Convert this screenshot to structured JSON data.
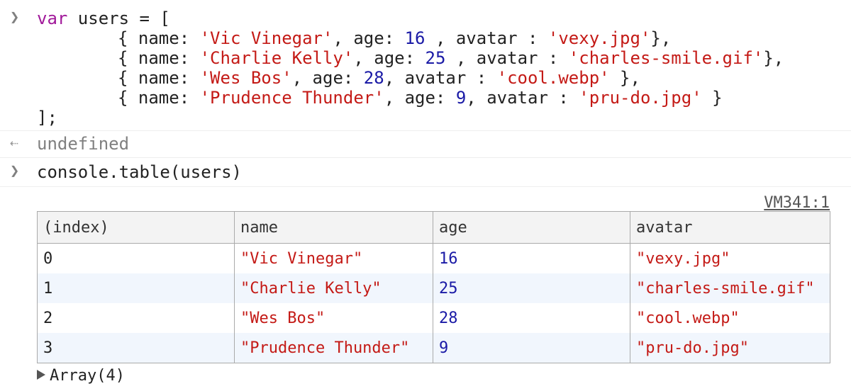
{
  "input1": {
    "prompt": ">",
    "code": {
      "l1_kw": "var",
      "l1_rest": " users = [",
      "rows": [
        {
          "name": "'Vic Vinegar'",
          "age": "16",
          "age_sep": " , ",
          "avatar": "'vexy.jpg'",
          "close": "},"
        },
        {
          "name": "'Charlie Kelly'",
          "age": "25",
          "age_sep": " , ",
          "avatar": "'charles-smile.gif'",
          "close": "},"
        },
        {
          "name": "'Wes Bos'",
          "age": "28",
          "age_sep": ", ",
          "avatar": "'cool.webp'",
          "close": " },"
        },
        {
          "name": "'Prudence Thunder'",
          "age": "9",
          "age_sep": ", ",
          "avatar": "'pru-do.jpg'",
          "close": " }"
        }
      ],
      "closing": "];"
    }
  },
  "output1": {
    "icon": "return-arrow-icon",
    "text": "undefined"
  },
  "input2": {
    "prompt": ">",
    "code": "console.table(users)"
  },
  "source_link": "VM341:1",
  "table": {
    "headers": [
      "(index)",
      "name",
      "age",
      "avatar"
    ],
    "rows": [
      {
        "index": "0",
        "name": "\"Vic Vinegar\"",
        "age": "16",
        "avatar": "\"vexy.jpg\""
      },
      {
        "index": "1",
        "name": "\"Charlie Kelly\"",
        "age": "25",
        "avatar": "\"charles-smile.gif\""
      },
      {
        "index": "2",
        "name": "\"Wes Bos\"",
        "age": "28",
        "avatar": "\"cool.webp\""
      },
      {
        "index": "3",
        "name": "\"Prudence Thunder\"",
        "age": "9",
        "avatar": "\"pru-do.jpg\""
      }
    ]
  },
  "array_toggle": "Array(4)",
  "colors": {
    "keyword": "#a1199a",
    "string": "#c41a16",
    "number": "#1a1aa6",
    "row_alt": "#f1f6fd",
    "header_bg": "#f3f3f3"
  }
}
